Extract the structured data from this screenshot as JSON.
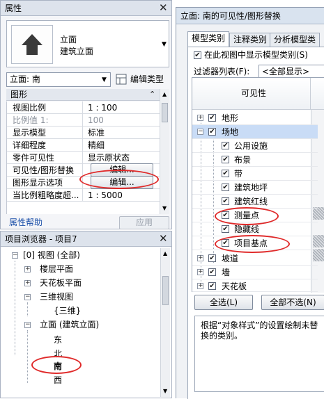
{
  "properties": {
    "title": "属性",
    "type_name": "立面",
    "type_sub": "建筑立面",
    "view_selector": "立面: 南",
    "edit_type_label": "编辑类型",
    "category": "图形",
    "rows": [
      {
        "key": "视图比例",
        "value": "1 : 100"
      },
      {
        "key": "比例值 1:",
        "value": "100"
      },
      {
        "key": "显示模型",
        "value": "标准"
      },
      {
        "key": "详细程度",
        "value": "精细"
      },
      {
        "key": "零件可见性",
        "value": "显示原状态"
      },
      {
        "key": "可见性/图形替换",
        "value": "编辑..."
      },
      {
        "key": "图形显示选项",
        "value": "编辑..."
      },
      {
        "key": "当比例粗略度超...",
        "value": "1 : 5000"
      }
    ],
    "help_link": "属性帮助",
    "apply_label": "应用"
  },
  "browser": {
    "title": "项目浏览器 - 项目7",
    "items": [
      {
        "label": "[0] 视图 (全部)"
      },
      {
        "label": "楼层平面"
      },
      {
        "label": "天花板平面"
      },
      {
        "label": "三维视图"
      },
      {
        "label": "{三维}"
      },
      {
        "label": "立面 (建筑立面)"
      },
      {
        "label": "东"
      },
      {
        "label": "北"
      },
      {
        "label": "南"
      },
      {
        "label": "西"
      }
    ]
  },
  "dialog": {
    "title": "立面: 南的可见性/图形替换",
    "tabs": [
      "模型类别",
      "注释类别",
      "分析模型类"
    ],
    "show_checkbox_label": "在此视图中显示模型类别(S)",
    "filter_label": "过滤器列表(F):",
    "filter_value": "<全部显示>",
    "column_header": "可见性",
    "tree": [
      {
        "label": "地形"
      },
      {
        "label": "场地"
      },
      {
        "label": "公用设施"
      },
      {
        "label": "布景"
      },
      {
        "label": "带"
      },
      {
        "label": "建筑地坪"
      },
      {
        "label": "建筑红线"
      },
      {
        "label": "测量点"
      },
      {
        "label": "隐藏线"
      },
      {
        "label": "项目基点"
      },
      {
        "label": "坡道"
      },
      {
        "label": "墙"
      },
      {
        "label": "天花板"
      }
    ],
    "select_all": "全选(L)",
    "select_none": "全部不选(N)",
    "description": "根据“对象样式”的设置绘制未替换的类别。"
  },
  "colors": {
    "highlight_oval": "#e02a2a",
    "selection": "#c9dcf6"
  }
}
